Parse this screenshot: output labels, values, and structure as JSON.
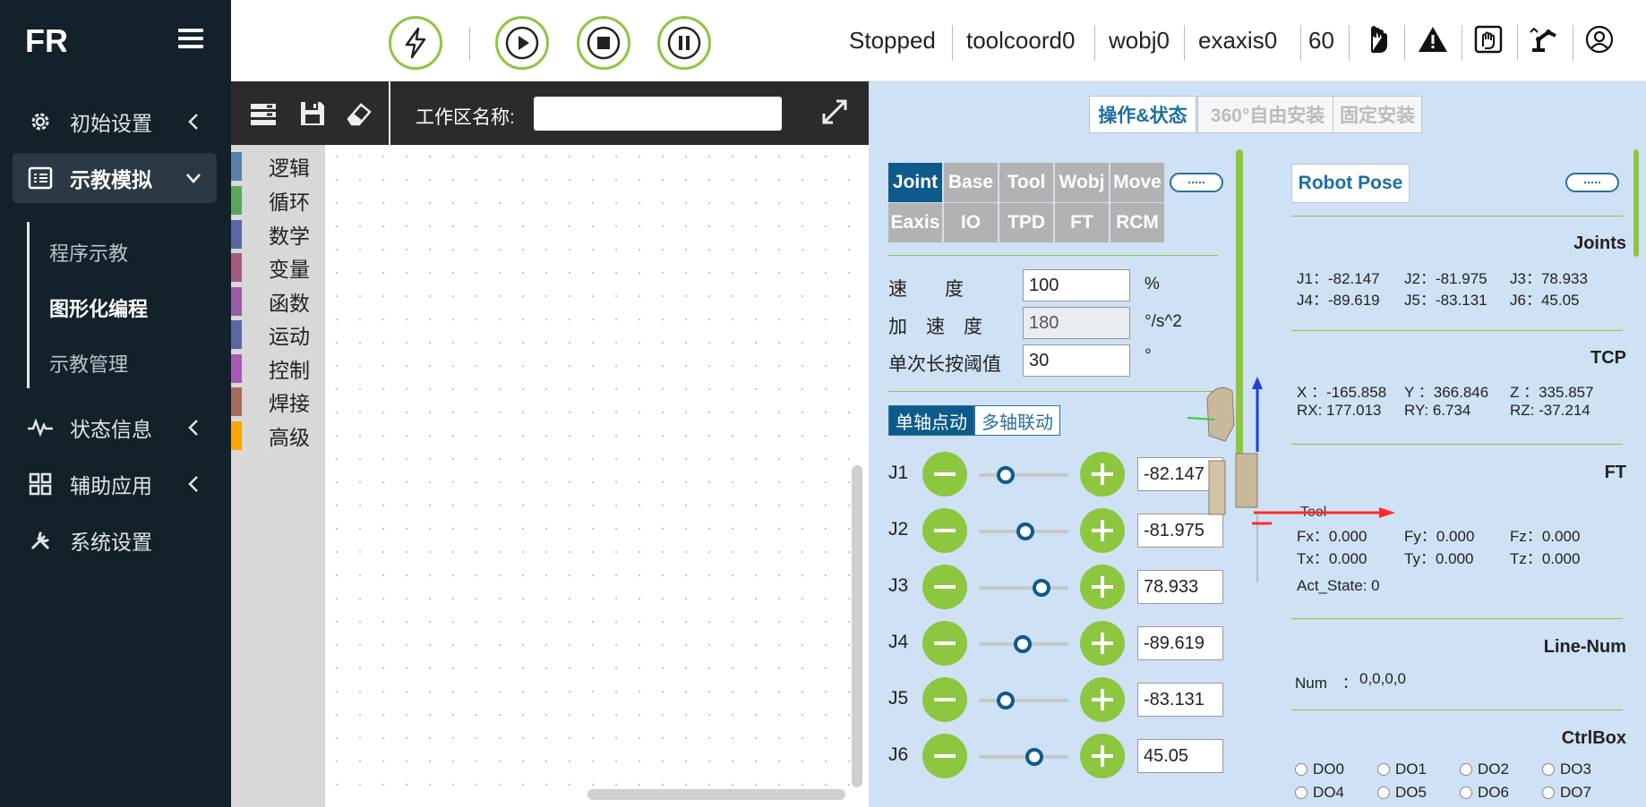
{
  "app": {
    "logo": "FR",
    "burger_icon": "menu-icon"
  },
  "sidebar": {
    "items": [
      {
        "label": "初始设置",
        "icon": "gear-icon"
      },
      {
        "label": "示教模拟",
        "icon": "list-icon"
      },
      {
        "label": "状态信息",
        "icon": "pulse-icon"
      },
      {
        "label": "辅助应用",
        "icon": "grid-icon"
      },
      {
        "label": "系统设置",
        "icon": "tools-icon"
      }
    ],
    "subitems": [
      {
        "label": "程序示教"
      },
      {
        "label": "图形化编程"
      },
      {
        "label": "示教管理"
      }
    ]
  },
  "topbar": {
    "controls": [
      "lightning-icon",
      "play-icon",
      "stop-icon",
      "pause-icon"
    ],
    "status": "Stopped",
    "tool": "toolcoord0",
    "wobj": "wobj0",
    "exaxis": "exaxis0",
    "speed": "60",
    "icons": [
      "hand-icon",
      "warning-icon",
      "hand-box-icon",
      "robot-arm-icon",
      "user-icon"
    ]
  },
  "toolbar": {
    "ws_label": "工作区名称:",
    "ws_value": ""
  },
  "categories": [
    {
      "label": "逻辑",
      "color": "#5b80a5"
    },
    {
      "label": "循环",
      "color": "#5ba55b"
    },
    {
      "label": "数学",
      "color": "#5b67a5"
    },
    {
      "label": "变量",
      "color": "#a55b80"
    },
    {
      "label": "函数",
      "color": "#995ba5"
    },
    {
      "label": "运动",
      "color": "#5b67a5"
    },
    {
      "label": "控制",
      "color": "#a55bb5"
    },
    {
      "label": "焊接",
      "color": "#a56c5b"
    },
    {
      "label": "高级",
      "color": "#ffa500"
    }
  ],
  "modes": [
    {
      "label": "操作&状态"
    },
    {
      "label": "360°自由安装"
    },
    {
      "label": "固定安装"
    }
  ],
  "ctrl": {
    "tabs": [
      "Joint",
      "Base",
      "Tool",
      "Wobj",
      "Move",
      "Eaxis",
      "IO",
      "TPD",
      "FT",
      "RCM"
    ],
    "params": [
      {
        "label": "速　　度",
        "value": "100",
        "unit": "%"
      },
      {
        "label": "加　速　度",
        "value": "180",
        "unit": "°/s^2"
      },
      {
        "label": "单次长按阈值",
        "value": "30",
        "unit": "°"
      }
    ],
    "jog_modes": [
      "单轴点动",
      "多轴联动"
    ],
    "joints": [
      {
        "name": "J1",
        "value": "-82.147",
        "pos": 0.3
      },
      {
        "name": "J2",
        "value": "-81.975",
        "pos": 0.52
      },
      {
        "name": "J3",
        "value": "78.933",
        "pos": 0.7
      },
      {
        "name": "J4",
        "value": "-89.619",
        "pos": 0.49
      },
      {
        "name": "J5",
        "value": "-83.131",
        "pos": 0.3
      },
      {
        "name": "J6",
        "value": "45.05",
        "pos": 0.62
      }
    ]
  },
  "scene": {
    "tool_label": "Tool"
  },
  "pose": {
    "button": "Robot Pose",
    "joints_title": "Joints",
    "joints": [
      "J1：-82.147",
      "J2：-81.975",
      "J3：78.933",
      "J4：-89.619",
      "J5：-83.131",
      "J6：45.05"
    ],
    "tcp_title": "TCP",
    "tcp": [
      "X ：-165.858",
      "Y ：366.846",
      "Z ：335.857",
      "RX: 177.013",
      "RY: 6.734",
      "RZ: -37.214"
    ],
    "ft_title": "FT",
    "ft": [
      "Fx：0.000",
      "Fy：0.000",
      "Fz：0.000",
      "Tx：0.000",
      "Ty：0.000",
      "Tz：0.000"
    ],
    "act_state": "Act_State: 0",
    "linenum_title": "Line-Num",
    "num_label": "Num　：",
    "num_value": "0,0,0,0",
    "ctrlbox_title": "CtrlBox",
    "dos": [
      "DO0",
      "DO1",
      "DO2",
      "DO3",
      "DO4",
      "DO5",
      "DO6",
      "DO7"
    ]
  }
}
